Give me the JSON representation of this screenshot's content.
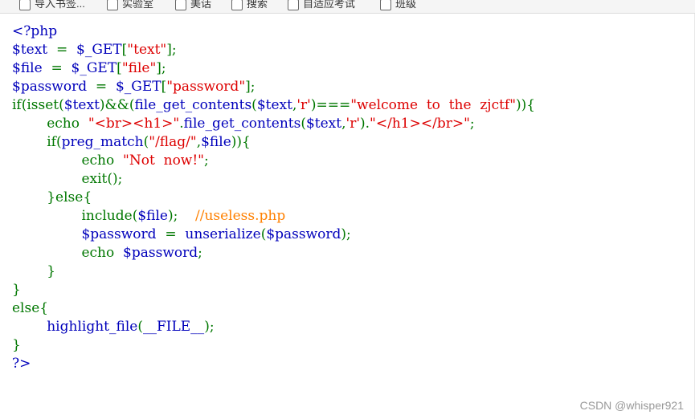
{
  "bookmarks": [
    {
      "label": "导入书签..."
    },
    {
      "label": "实验室"
    },
    {
      "label": "美话"
    },
    {
      "label": "搜索"
    },
    {
      "label": "自适应考试"
    },
    {
      "label": "班级"
    }
  ],
  "code": {
    "lines": [
      [
        {
          "t": "<?php",
          "c": "dflt"
        }
      ],
      [
        {
          "t": "$text",
          "c": "dflt"
        },
        {
          "t": "  =  ",
          "c": "kw"
        },
        {
          "t": "$_GET",
          "c": "dflt"
        },
        {
          "t": "[",
          "c": "kw"
        },
        {
          "t": "\"text\"",
          "c": "str"
        },
        {
          "t": "];",
          "c": "kw"
        }
      ],
      [
        {
          "t": "$file",
          "c": "dflt"
        },
        {
          "t": "  =  ",
          "c": "kw"
        },
        {
          "t": "$_GET",
          "c": "dflt"
        },
        {
          "t": "[",
          "c": "kw"
        },
        {
          "t": "\"file\"",
          "c": "str"
        },
        {
          "t": "];",
          "c": "kw"
        }
      ],
      [
        {
          "t": "$password",
          "c": "dflt"
        },
        {
          "t": "  =  ",
          "c": "kw"
        },
        {
          "t": "$_GET",
          "c": "dflt"
        },
        {
          "t": "[",
          "c": "kw"
        },
        {
          "t": "\"password\"",
          "c": "str"
        },
        {
          "t": "];",
          "c": "kw"
        }
      ],
      [
        {
          "t": "if(isset(",
          "c": "kw"
        },
        {
          "t": "$text",
          "c": "dflt"
        },
        {
          "t": ")&&(",
          "c": "kw"
        },
        {
          "t": "file_get_contents",
          "c": "dflt"
        },
        {
          "t": "(",
          "c": "kw"
        },
        {
          "t": "$text",
          "c": "dflt"
        },
        {
          "t": ",",
          "c": "kw"
        },
        {
          "t": "'r'",
          "c": "str"
        },
        {
          "t": ")===",
          "c": "kw"
        },
        {
          "t": "\"welcome  to  the  zjctf\"",
          "c": "str"
        },
        {
          "t": ")){",
          "c": "kw"
        }
      ],
      [
        {
          "t": "        echo  ",
          "c": "kw"
        },
        {
          "t": "\"<br><h1>\"",
          "c": "str"
        },
        {
          "t": ".",
          "c": "kw"
        },
        {
          "t": "file_get_contents",
          "c": "dflt"
        },
        {
          "t": "(",
          "c": "kw"
        },
        {
          "t": "$text",
          "c": "dflt"
        },
        {
          "t": ",",
          "c": "kw"
        },
        {
          "t": "'r'",
          "c": "str"
        },
        {
          "t": ").",
          "c": "kw"
        },
        {
          "t": "\"</h1></br>\"",
          "c": "str"
        },
        {
          "t": ";",
          "c": "kw"
        }
      ],
      [
        {
          "t": "        if(",
          "c": "kw"
        },
        {
          "t": "preg_match",
          "c": "dflt"
        },
        {
          "t": "(",
          "c": "kw"
        },
        {
          "t": "\"/flag/\"",
          "c": "str"
        },
        {
          "t": ",",
          "c": "kw"
        },
        {
          "t": "$file",
          "c": "dflt"
        },
        {
          "t": ")){",
          "c": "kw"
        }
      ],
      [
        {
          "t": "                echo  ",
          "c": "kw"
        },
        {
          "t": "\"Not  now!\"",
          "c": "str"
        },
        {
          "t": ";",
          "c": "kw"
        }
      ],
      [
        {
          "t": "                exit();",
          "c": "kw"
        }
      ],
      [
        {
          "t": "        }else{",
          "c": "kw"
        }
      ],
      [
        {
          "t": "                include(",
          "c": "kw"
        },
        {
          "t": "$file",
          "c": "dflt"
        },
        {
          "t": ");    ",
          "c": "kw"
        },
        {
          "t": "//useless.php",
          "c": "cmt"
        }
      ],
      [
        {
          "t": "                ",
          "c": "kw"
        },
        {
          "t": "$password",
          "c": "dflt"
        },
        {
          "t": "  =  ",
          "c": "kw"
        },
        {
          "t": "unserialize",
          "c": "dflt"
        },
        {
          "t": "(",
          "c": "kw"
        },
        {
          "t": "$password",
          "c": "dflt"
        },
        {
          "t": ");",
          "c": "kw"
        }
      ],
      [
        {
          "t": "                echo  ",
          "c": "kw"
        },
        {
          "t": "$password",
          "c": "dflt"
        },
        {
          "t": ";",
          "c": "kw"
        }
      ],
      [
        {
          "t": "        }",
          "c": "kw"
        }
      ],
      [
        {
          "t": "}",
          "c": "kw"
        }
      ],
      [
        {
          "t": "else{",
          "c": "kw"
        }
      ],
      [
        {
          "t": "        ",
          "c": "kw"
        },
        {
          "t": "highlight_file",
          "c": "dflt"
        },
        {
          "t": "(",
          "c": "kw"
        },
        {
          "t": "__FILE__",
          "c": "dflt"
        },
        {
          "t": ");",
          "c": "kw"
        }
      ],
      [
        {
          "t": "}",
          "c": "kw"
        }
      ],
      [
        {
          "t": "?>",
          "c": "dflt"
        }
      ]
    ]
  },
  "watermark": "CSDN @whisper921",
  "colors": {
    "keyword": "#007700",
    "default": "#0000BB",
    "string": "#DD0000",
    "comment": "#FF8000"
  }
}
